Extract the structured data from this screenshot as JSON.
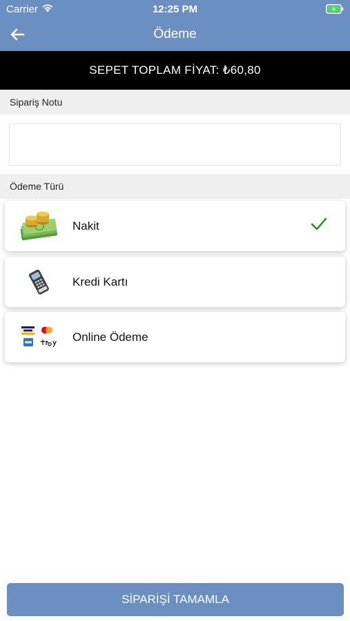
{
  "status_bar": {
    "carrier": "Carrier",
    "time": "12:25 PM"
  },
  "nav": {
    "title": "Ödeme",
    "back_icon": "arrow-left-icon"
  },
  "total": {
    "text": "SEPET TOPLAM FİYAT: ₺60,80"
  },
  "note": {
    "label": "Sipariş Notu",
    "value": ""
  },
  "payment": {
    "label": "Ödeme Türü",
    "selected": "Nakit",
    "methods": [
      {
        "label": "Nakit",
        "icon": "cash-money-icon"
      },
      {
        "label": "Kredi Kartı",
        "icon": "pos-terminal-icon"
      },
      {
        "label": "Online Ödeme",
        "icon": "card-logos-icon"
      }
    ]
  },
  "actions": {
    "complete_label": "SİPARİŞİ TAMAMLA"
  },
  "colors": {
    "primary": "#6c8fc2",
    "check": "#1f8a2a",
    "total_bg": "#000000"
  }
}
